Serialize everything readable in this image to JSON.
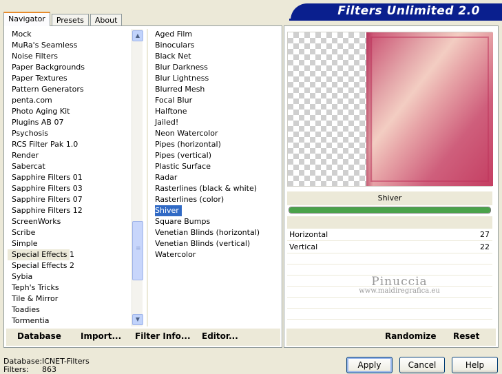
{
  "tabs": [
    "Navigator",
    "Presets",
    "About"
  ],
  "banner": "Filters Unlimited 2.0",
  "categories": [
    "Mock",
    "MuRa's Seamless",
    "Noise Filters",
    "Paper Backgrounds",
    "Paper Textures",
    "Pattern Generators",
    "penta.com",
    "Photo Aging Kit",
    "Plugins AB 07",
    "Psychosis",
    "RCS Filter Pak 1.0",
    "Render",
    "Sabercat",
    "Sapphire Filters 01",
    "Sapphire Filters 03",
    "Sapphire Filters 07",
    "Sapphire Filters 12",
    "ScreenWorks",
    "Scribe",
    "Simple",
    "Special Effects 1",
    "Special Effects 2",
    "Sybia",
    "Teph's Tricks",
    "Tile & Mirror",
    "Toadies",
    "Tormentia"
  ],
  "selected_category": "Special Effects 1",
  "filters": [
    "Aged Film",
    "Binoculars",
    "Black Net",
    "Blur Darkness",
    "Blur Lightness",
    "Blurred Mesh",
    "Focal Blur",
    "Halftone",
    "Jailed!",
    "Neon Watercolor",
    "Pipes (horizontal)",
    "Pipes (vertical)",
    "Plastic Surface",
    "Radar",
    "Rasterlines (black & white)",
    "Rasterlines (color)",
    "Shiver",
    "Square Bumps",
    "Venetian Blinds (horizontal)",
    "Venetian Blinds (vertical)",
    "Watercolor"
  ],
  "selected_filter": "Shiver",
  "left_buttons": {
    "database": "Database",
    "import": "Import...",
    "filter_info": "Filter Info...",
    "editor": "Editor..."
  },
  "preview": {
    "filter_name": "Shiver",
    "progress": 1.0
  },
  "params": [
    {
      "label": "Horizontal",
      "value": "27"
    },
    {
      "label": "Vertical",
      "value": "22"
    }
  ],
  "watermark": {
    "name": "Pinuccia",
    "url": "www.maidiregrafica.eu"
  },
  "right_buttons": {
    "randomize": "Randomize",
    "reset": "Reset"
  },
  "status": {
    "database_label": "Database:",
    "database_value": "ICNET-Filters",
    "filters_label": "Filters:",
    "filters_value": "863"
  },
  "dialog_buttons": {
    "apply": "Apply",
    "cancel": "Cancel",
    "help": "Help"
  },
  "colors": {
    "banner": "#0a1f8e",
    "selection": "#316ac5",
    "tab_accent": "#e68b2c"
  }
}
